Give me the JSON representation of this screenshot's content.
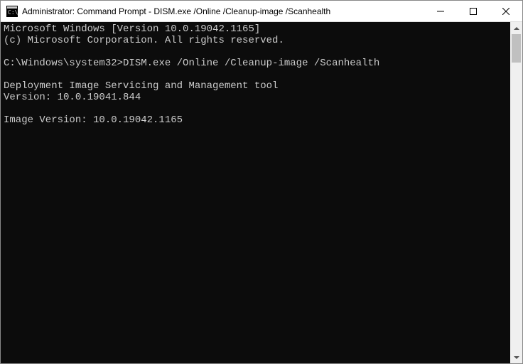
{
  "titlebar": {
    "title": "Administrator: Command Prompt - DISM.exe  /Online /Cleanup-image /Scanhealth"
  },
  "console": {
    "line1": "Microsoft Windows [Version 10.0.19042.1165]",
    "line2": "(c) Microsoft Corporation. All rights reserved.",
    "blank": "",
    "prompt_path": "C:\\Windows\\system32>",
    "command": "DISM.exe /Online /Cleanup-image /Scanhealth",
    "tool_line1": "Deployment Image Servicing and Management tool",
    "tool_line2": "Version: 10.0.19041.844",
    "image_version": "Image Version: 10.0.19042.1165"
  }
}
